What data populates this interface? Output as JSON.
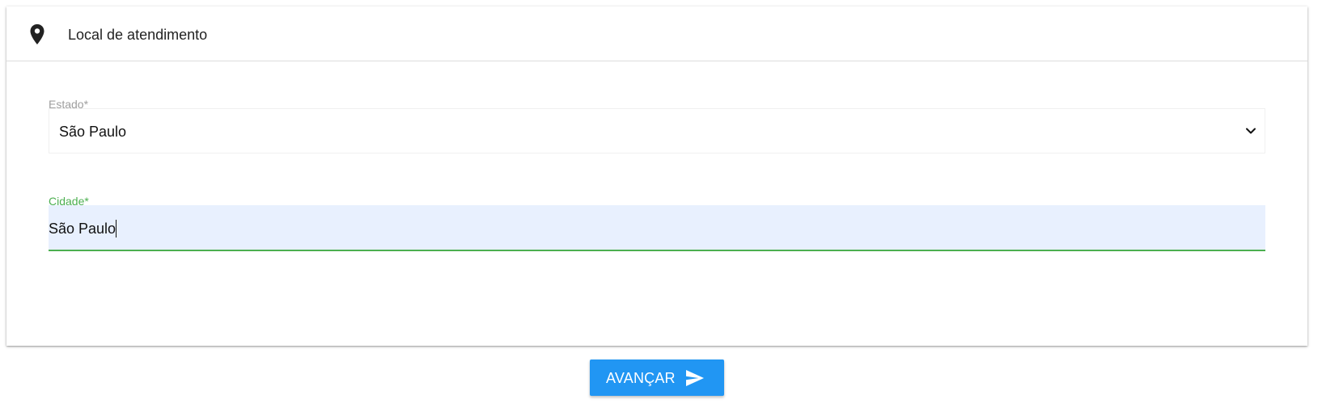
{
  "card": {
    "title": "Local de atendimento",
    "icon": "map-pin-icon"
  },
  "estado": {
    "label": "Estado*",
    "value": "São Paulo",
    "icon": "chevron-down-icon"
  },
  "cidade": {
    "label": "Cidade*",
    "value": "São Paulo"
  },
  "button": {
    "label": "AVANÇAR",
    "icon": "send-icon"
  },
  "colors": {
    "primary": "#2196f3",
    "focus": "#4caf50",
    "autofill": "#e8f0fe"
  }
}
